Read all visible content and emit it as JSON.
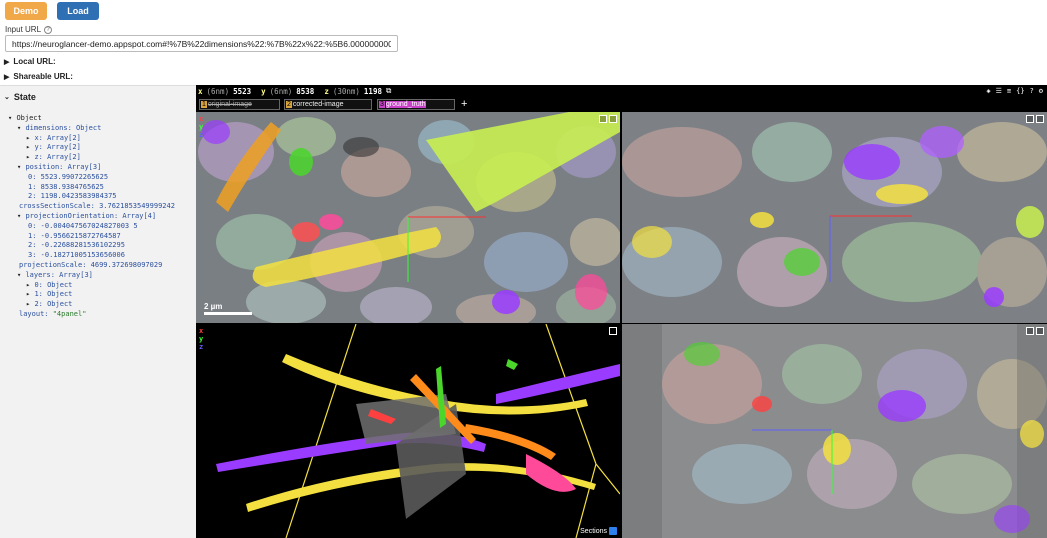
{
  "buttons": {
    "demo": "Demo",
    "load": "Load"
  },
  "input": {
    "label": "Input URL",
    "value": "https://neuroglancer-demo.appspot.com#!%7B%22dimensions%22:%7B%22x%22:%5B6.00000000000000"
  },
  "disclosures": {
    "local": "Local URL:",
    "shareable": "Shareable URL:"
  },
  "state": {
    "header": "State",
    "rows": [
      "Object",
      "dimensions: Object",
      "x: Array[2]",
      "y: Array[2]",
      "z: Array[2]",
      "position: Array[3]",
      "0: 5523.99072265625",
      "1: 8538.9384765625",
      "2: 1198.0423583984375",
      "crossSectionScale: 3.7621853549999242",
      "projectionOrientation: Array[4]",
      "0: -0.004047567024827003 5",
      "1: -0.9566215872764587",
      "2: -0.22688281536102295",
      "3: -0.18271005153656006",
      "projectionScale: 4699.372698097029",
      "layers: Array[3]",
      "0: Object",
      "1: Object",
      "2: Object",
      "layout: \"4panel\""
    ]
  },
  "coords": {
    "x_label": "x",
    "x_unit": "(6nm)",
    "x_val": "5523",
    "y_label": "y",
    "y_unit": "(6nm)",
    "y_val": "8538",
    "z_label": "z",
    "z_unit": "(30nm)",
    "z_val": "1198"
  },
  "layers": [
    {
      "num": "1",
      "name": "original-image"
    },
    {
      "num": "2",
      "name": "corrected-image"
    },
    {
      "num": "3",
      "name": "ground_truth"
    }
  ],
  "add_layer": "+",
  "scale_label": "2 µm",
  "axes": {
    "x": "x",
    "y": "y",
    "z": "z"
  },
  "sections_label": "Sections",
  "colors": {
    "demo": "#f0a848",
    "load": "#2f6fb3",
    "segment_yellow": "#f3e040",
    "segment_purple": "#9a3cff",
    "segment_orange": "#ff8c1a",
    "segment_green": "#4ad62a",
    "segment_pink": "#ff4a9a"
  }
}
